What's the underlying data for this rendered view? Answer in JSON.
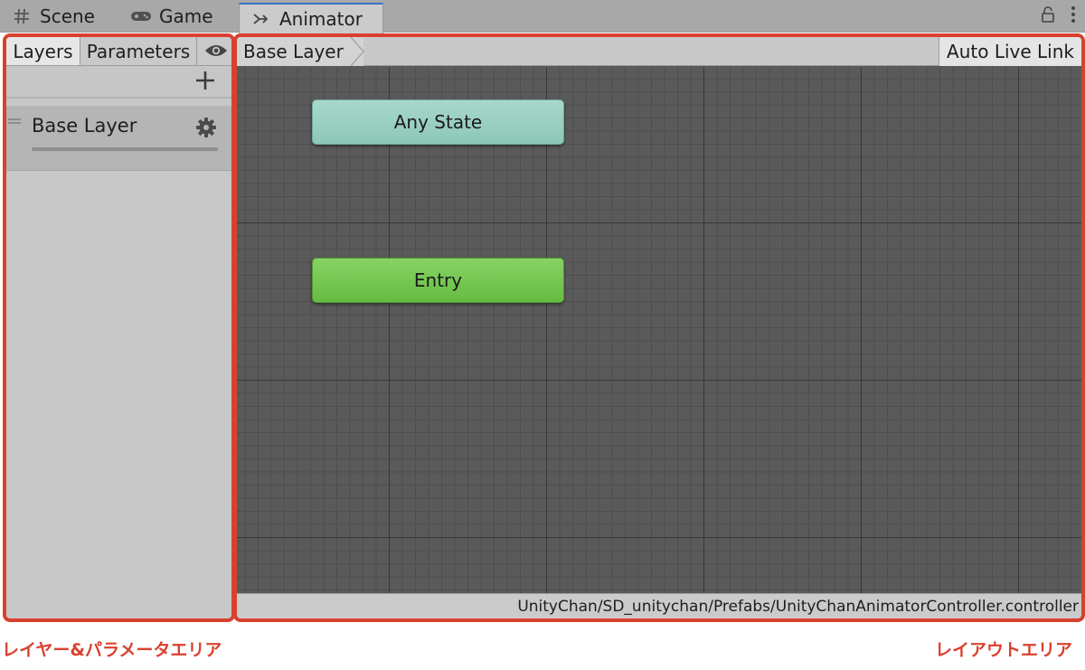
{
  "window_tabs": [
    {
      "label": "Scene",
      "icon": "grid-icon"
    },
    {
      "label": "Game",
      "icon": "gamepad-icon"
    },
    {
      "label": "Animator",
      "icon": "animator-icon",
      "active": true
    }
  ],
  "window_controls": {
    "lock_icon": "lock-icon",
    "menu_icon": "more-vertical-icon"
  },
  "left_panel": {
    "tabs": {
      "layers": "Layers",
      "parameters": "Parameters",
      "visibility_icon": "eye-icon"
    },
    "add_icon": "plus-icon",
    "layers": [
      {
        "name": "Base Layer",
        "settings_icon": "gear-icon"
      }
    ]
  },
  "graph": {
    "breadcrumb": "Base Layer",
    "auto_live_link": "Auto Live Link",
    "states": [
      {
        "name": "Any State",
        "color": "#9ccfc2"
      },
      {
        "name": "Entry",
        "color": "#74c64f"
      }
    ],
    "controller_path": "UnityChan/SD_unitychan/Prefabs/UnityChanAnimatorController.controller"
  },
  "annotations": {
    "left": "レイヤー&パラメータエリア",
    "right": "レイアウトエリア",
    "color": "#d9412f"
  }
}
